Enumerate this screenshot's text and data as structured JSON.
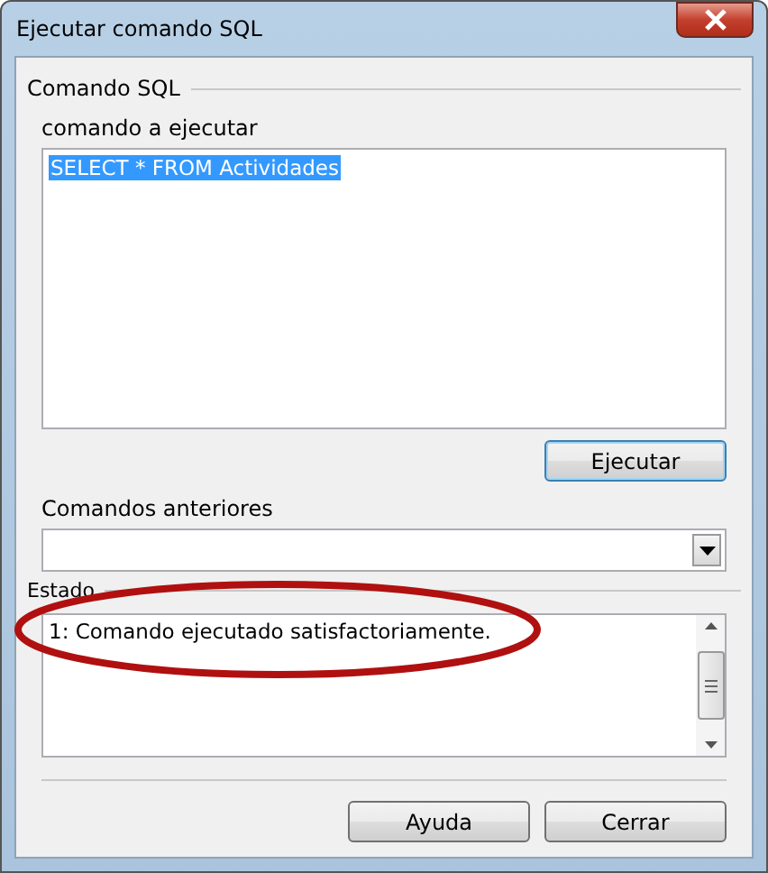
{
  "window": {
    "title": "Ejecutar comando SQL"
  },
  "group": {
    "title": "Comando SQL"
  },
  "command": {
    "label": "comando a ejecutar",
    "value": "SELECT * FROM Actividades",
    "selected": true
  },
  "execute_button": "Ejecutar",
  "previous": {
    "label": "Comandos anteriores"
  },
  "status": {
    "label": "Estado",
    "message": "1: Comando ejecutado satisfactoriamente.",
    "highlighted": true
  },
  "buttons": [
    "Ayuda",
    "Cerrar"
  ]
}
